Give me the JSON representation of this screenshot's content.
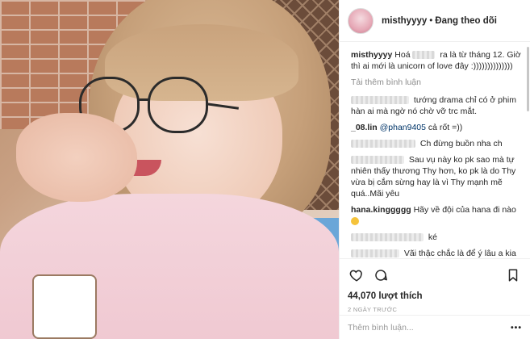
{
  "post": {
    "username": "misthyyyy",
    "separator": "•",
    "follow_status": "Đang theo dõi",
    "caption_part1": "Hoá",
    "caption_part2": "ra là từ tháng 12. Giờ thì ai mới là unicorn of love đây :))))))))))))))"
  },
  "comments": {
    "load_more": "Tải thêm bình luận",
    "items": [
      {
        "text": "tướng drama chỉ có ở phim hàn ai mà ngờ nó chờ vỡ trc mắt."
      },
      {
        "name": "_08.lin",
        "mention": "@phan9405",
        "text": "cả rốt =))"
      },
      {
        "text": "Ch đừng buồn nha ch"
      },
      {
        "text": "Sau vụ này ko pk sao mà tự nhiên thấy thương Thy hơn, ko pk là do Thy vừa bị cắm sừng hay là vì Thy mạnh mẽ quá..Mãi yêu"
      },
      {
        "name": "hana.kinggggg",
        "text": "Hãy về đội của hana đi nào"
      },
      {
        "text": "ké"
      },
      {
        "text": "Vãi thậc chắc là để ý lâu a kia lâu rồi lợi dụng thy xong thì vứt thôi!!! Tôi"
      }
    ]
  },
  "actions": {
    "likes": "44,070 lượt thích",
    "time_ago": "2 NGÀY TRƯỚC"
  },
  "footer": {
    "comment_placeholder": "Thêm bình luận...",
    "more_dots": "•••"
  }
}
